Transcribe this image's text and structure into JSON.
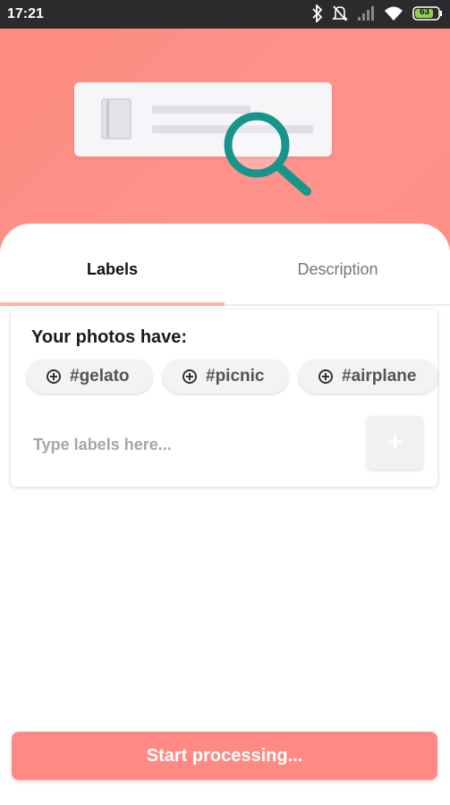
{
  "status_bar": {
    "time": "17:21",
    "battery": "63"
  },
  "tabs": [
    {
      "label": "Labels",
      "active": true
    },
    {
      "label": "Description",
      "active": false
    }
  ],
  "labels_panel": {
    "title": "Your photos have:",
    "chips": [
      "#gelato",
      "#picnic",
      "#airplane"
    ],
    "input_placeholder": "Type labels here...",
    "input_value": "",
    "add_button_icon": "plus-icon"
  },
  "start_button": {
    "label": "Start processing..."
  },
  "colors": {
    "accent": "#ff8a84",
    "hero": "#fc8b80",
    "tab_indicator": "#ffb49f",
    "magnifier": "#17958a"
  }
}
